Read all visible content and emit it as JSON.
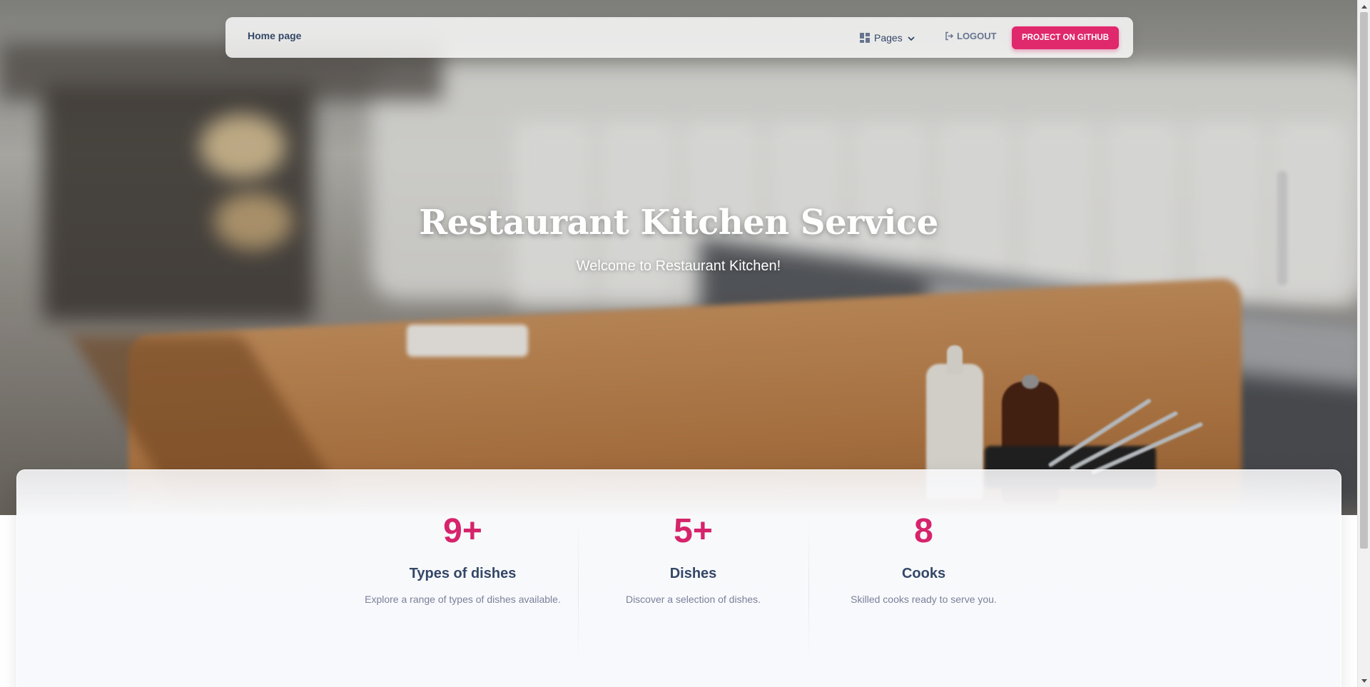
{
  "navbar": {
    "brand": "Home page",
    "pages_label": "Pages",
    "logout_label": "LOGOUT",
    "github_label": "PROJECT ON GITHUB"
  },
  "hero": {
    "title": "Restaurant Kitchen Service",
    "subtitle": "Welcome to Restaurant Kitchen!"
  },
  "stats": [
    {
      "value": "9+",
      "label": "Types of dishes",
      "description": "Explore a range of types of dishes available."
    },
    {
      "value": "5+",
      "label": "Dishes",
      "description": "Discover a selection of dishes."
    },
    {
      "value": "8",
      "label": "Cooks",
      "description": "Skilled cooks ready to serve you."
    }
  ],
  "colors": {
    "accent": "#e0286c",
    "stat_number": "#d6246b",
    "heading": "#344767",
    "muted": "#7b809a"
  },
  "icons": {
    "pages": "dashboard-grid-icon",
    "pages_toggle": "chevron-down-icon",
    "logout": "logout-icon"
  }
}
